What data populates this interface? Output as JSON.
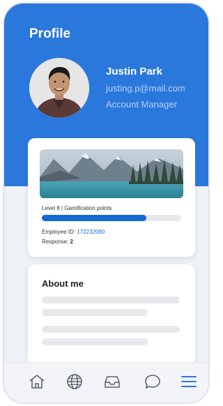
{
  "header": {
    "title": "Profile",
    "background": "#2a78dc"
  },
  "profile": {
    "name": "Justin Park",
    "email": "justing.p@mail.com",
    "role": "Account Manager"
  },
  "stats_card": {
    "level_text": "Level 8  |  Gamification points",
    "progress": 0.75,
    "employee_id_label": "Employee ID:",
    "employee_id_value": "172232090",
    "response_label": "Response:",
    "response_value": "2"
  },
  "about": {
    "title": "About me"
  },
  "nav": {
    "items": [
      {
        "icon": "home-icon"
      },
      {
        "icon": "globe-icon"
      },
      {
        "icon": "inbox-icon"
      },
      {
        "icon": "chat-bubble-icon"
      },
      {
        "icon": "menu-icon",
        "active": true
      }
    ],
    "active_color": "#2a78dc",
    "inactive_color": "#5b6270"
  }
}
